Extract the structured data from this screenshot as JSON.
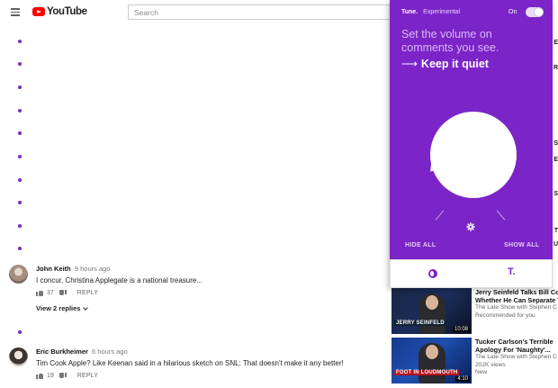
{
  "youtube": {
    "logo_text": "YouTube",
    "search_placeholder": "Search"
  },
  "comments": [
    {
      "author": "John Keith",
      "time": "9 hours ago",
      "text": "I concur, Christina Applegate is a national treasure...",
      "likes": "37",
      "reply_label": "REPLY",
      "view_replies": "View 2 replies"
    },
    {
      "author": "Eric Burkheimer",
      "time": "6 hours ago",
      "text": "Tim Cook Apple? Like Keenan said in a hilarious sketch on SNL: That doesn't make it any better!",
      "likes": "19",
      "reply_label": "REPLY"
    }
  ],
  "sidebar_videos": [
    {
      "title_line1": "Jerry Seinfeld Talks Bill Co",
      "title_line2": "Whether He Can Separate T",
      "channel": "The Late Show with Stephen C",
      "meta": "Recommended for you",
      "thumb_caption": "JERRY SEINFELD",
      "duration": "10:08"
    },
    {
      "title_line1": "Tucker Carlson's Terrible",
      "title_line2": "Apology For 'Naughty'...",
      "channel": "The Late Show with Stephen C",
      "meta": "202K views",
      "badge": "New",
      "thumb_caption": "FOOT IN LOUDMOUTH",
      "duration": "4:10"
    }
  ],
  "sidebar_fragments": [
    "E",
    "R",
    "S",
    "E",
    "S",
    "T",
    "U"
  ],
  "extension": {
    "brand": "Tune.",
    "mode": "Experimental",
    "toggle_label": "On",
    "toggle_on": true,
    "headline": "Set the volume on comments you see.",
    "cta_arrow": "⟶",
    "cta": "Keep it quiet",
    "hide_all": "HIDE ALL",
    "show_all": "SHOW ALL",
    "footer_logo": "T.",
    "icons": [
      "settings-gear-icon",
      "tune-home-icon"
    ]
  },
  "colors": {
    "accent_purple": "#7b24c7",
    "youtube_red": "#ff0000"
  }
}
